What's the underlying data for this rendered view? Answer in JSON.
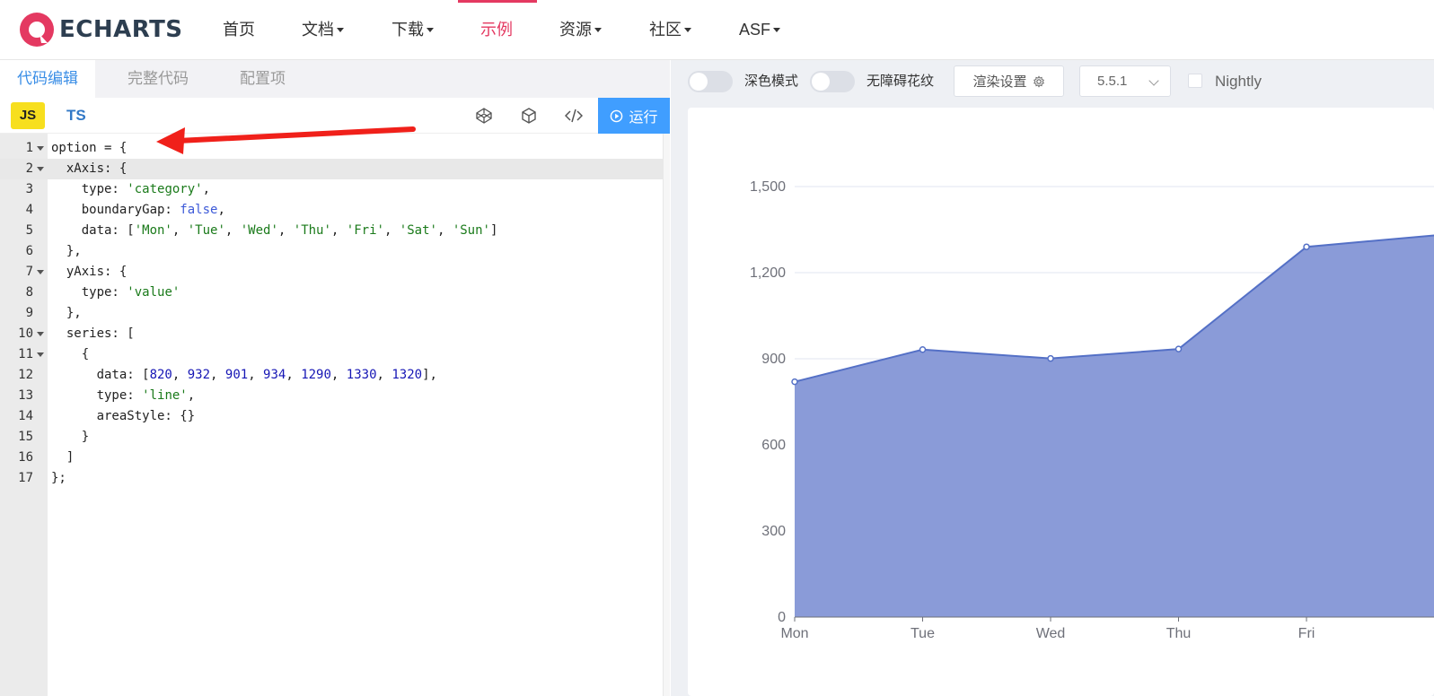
{
  "nav": {
    "logo_text": "ECHARTS",
    "items": [
      {
        "label": "首页",
        "dropdown": false
      },
      {
        "label": "文档",
        "dropdown": true
      },
      {
        "label": "下载",
        "dropdown": true
      },
      {
        "label": "示例",
        "dropdown": false,
        "active": true
      },
      {
        "label": "资源",
        "dropdown": true
      },
      {
        "label": "社区",
        "dropdown": true
      },
      {
        "label": "ASF",
        "dropdown": true
      }
    ]
  },
  "editor": {
    "tabs": [
      "代码编辑",
      "完整代码",
      "配置项"
    ],
    "active_tab": 0,
    "lang_js": "JS",
    "lang_ts": "TS",
    "run_label": "运行",
    "tool_icons": [
      "codepen-icon",
      "codesandbox-icon",
      "code-embed-icon"
    ],
    "lines": [
      "option = {",
      "  xAxis: {",
      "    type: 'category',",
      "    boundaryGap: false,",
      "    data: ['Mon', 'Tue', 'Wed', 'Thu', 'Fri', 'Sat', 'Sun']",
      "  },",
      "  yAxis: {",
      "    type: 'value'",
      "  },",
      "  series: [",
      "    {",
      "      data: [820, 932, 901, 934, 1290, 1330, 1320],",
      "      type: 'line',",
      "      areaStyle: {}",
      "    }",
      "  ]",
      "};"
    ],
    "foldable_lines": [
      1,
      2,
      7,
      10,
      11
    ],
    "active_line": 2
  },
  "preview": {
    "dark_mode_label": "深色模式",
    "accessibility_label": "无障碍花纹",
    "render_settings_label": "渲染设置",
    "version": "5.5.1",
    "nightly_label": "Nightly"
  },
  "colors": {
    "accent": "#e43961",
    "run_button": "#409eff",
    "series_line": "#5470c6",
    "series_area": "#8a9bd8"
  },
  "chart_data": {
    "type": "area",
    "categories": [
      "Mon",
      "Tue",
      "Wed",
      "Thu",
      "Fri",
      "Sat",
      "Sun"
    ],
    "visible_categories": [
      "Mon",
      "Tue",
      "Wed",
      "Thu",
      "Fri"
    ],
    "values": [
      820,
      932,
      901,
      934,
      1290,
      1330,
      1320
    ],
    "yticks": [
      "0",
      "300",
      "600",
      "900",
      "1,200",
      "1,500"
    ],
    "ylim": [
      0,
      1500
    ],
    "grid": true
  }
}
